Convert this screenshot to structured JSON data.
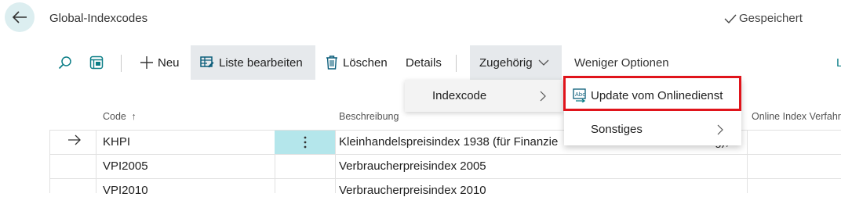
{
  "header": {
    "title": "Global-Indexcodes",
    "saved_label": "Gespeichert"
  },
  "toolbar": {
    "new_label": "Neu",
    "edit_list_label": "Liste bearbeiten",
    "delete_label": "Löschen",
    "details_label": "Details",
    "related_label": "Zugehörig",
    "fewer_options_label": "Weniger Optionen",
    "cut_label": "L"
  },
  "columns": {
    "code": "Code",
    "code_sort": "↑",
    "description": "Beschreibung",
    "online_index": "Online Index Verfahr"
  },
  "rows": [
    {
      "code": "KHPI",
      "description": "Kleinhandelspreisindex 1938 (für Finanzie",
      "description_tail": "g), ",
      "selected": true
    },
    {
      "code": "VPI2005",
      "description": "Verbraucherpreisindex 2005"
    },
    {
      "code": "VPI2010",
      "description": "Verbraucherpreisindex 2010"
    }
  ],
  "menu": {
    "indexcode_label": "Indexcode",
    "update_label": "Update vom Onlinedienst",
    "other_label": "Sonstiges"
  },
  "colors": {
    "accent": "#008489",
    "selected_cell": "#b4e6eb",
    "highlight": "#e0141b"
  }
}
